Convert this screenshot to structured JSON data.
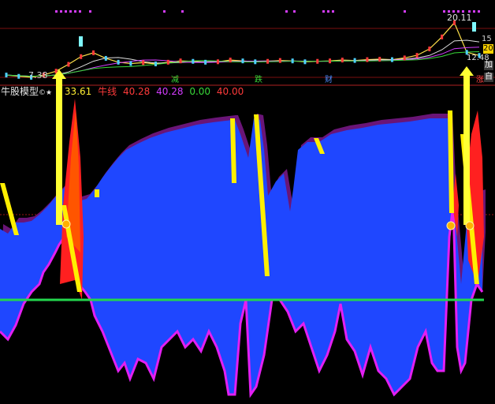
{
  "price_panel": {
    "high_label": "20.11",
    "low_label": "7.38",
    "last_label": "12.48",
    "right_value_label": "20",
    "mid_right_label": "15",
    "side_buttons": [
      "加",
      "自"
    ],
    "event_markers": [
      "减",
      "跌",
      "财",
      "涨"
    ]
  },
  "indicator": {
    "name": "牛股模型",
    "name_suffix": "©★",
    "value1": "33.61",
    "series_label": "牛线",
    "value2": "40.28",
    "value3": "40.28",
    "value4": "0.00",
    "value5": "40.00"
  },
  "colors": {
    "blue_fill": "#1f47ff",
    "magenta": "#e31ff2",
    "dark_purple": "#6a1577",
    "yellow": "#ffef00",
    "red": "#ff2020",
    "orange": "#ff5500",
    "green_line": "#23d64d",
    "grid_red": "#9b1515",
    "label_red": "#ff3a3a",
    "label_magenta": "#d43cff",
    "label_green": "#38d838",
    "label_yellow": "#ffee33"
  },
  "chart_data": [
    {
      "type": "line",
      "title": "",
      "series": [
        {
          "values": [
            7.9,
            7.6,
            7.38,
            7.9,
            8.8,
            10.4,
            12.2,
            13.1,
            11.8,
            10.9,
            10.6,
            10.8,
            10.5,
            10.9,
            11.2,
            11.1,
            10.9,
            11.0,
            11.4,
            11.2,
            11.0,
            11.1,
            11.3,
            11.2,
            11.0,
            11.1,
            11.2,
            11.4,
            11.3,
            11.5,
            11.6,
            11.5,
            11.9,
            12.5,
            14.0,
            16.8,
            20.11,
            13.2,
            12.48
          ]
        }
      ],
      "annotations": [
        "20.11",
        "7.38",
        "12.48"
      ]
    },
    {
      "type": "area",
      "title": "牛股模型",
      "y_reference_levels": [
        40.0,
        0.0
      ],
      "series": [
        {
          "name": "牛线",
          "values": [
            40.28
          ]
        }
      ],
      "shapes": [
        "blue area",
        "magenta outline",
        "yellow bands",
        "red/orange spikes",
        "green horizontal line"
      ]
    }
  ]
}
